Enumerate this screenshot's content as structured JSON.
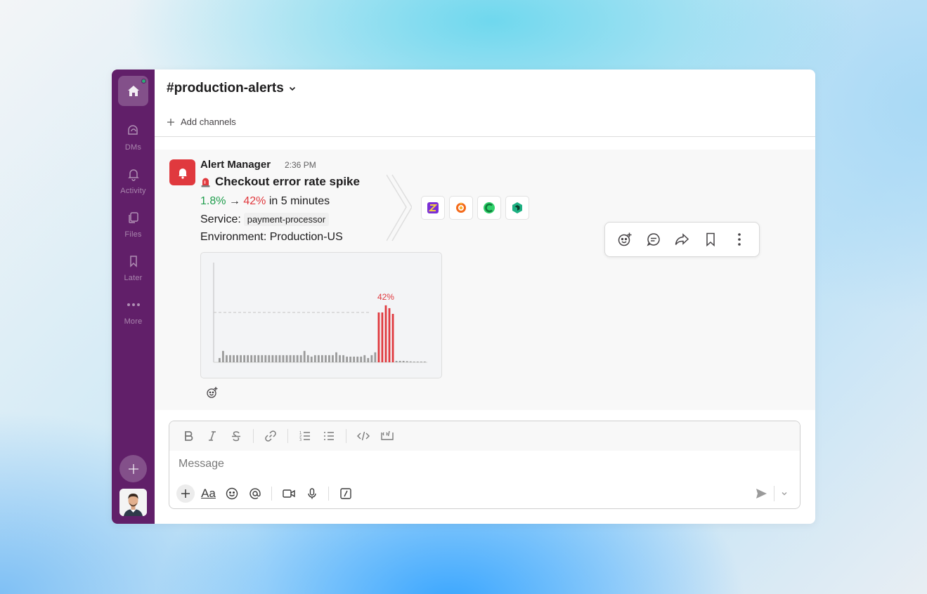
{
  "rail": {
    "items": [
      {
        "label": "DMs",
        "icon": "dms-icon"
      },
      {
        "label": "Activity",
        "icon": "bell-icon"
      },
      {
        "label": "Files",
        "icon": "files-icon"
      },
      {
        "label": "Later",
        "icon": "bookmark-icon"
      },
      {
        "label": "More",
        "icon": "more-dots-icon"
      }
    ],
    "home_icon": "home-icon",
    "presence_color": "#2bac76",
    "accent": "#611f69"
  },
  "header": {
    "channel_name": "#production-alerts",
    "add_channels": "Add channels"
  },
  "message": {
    "sender": "Alert Manager",
    "time": "2:36 PM",
    "title": "Checkout error rate spike",
    "rate_from": "1.8%",
    "arrow": "→",
    "rate_to": "42%",
    "rate_suffix": "in 5 minutes",
    "service_label": "Service:",
    "service_value": "payment-processor",
    "environment": "Environment: Production-US",
    "apps": [
      "app-icon-1",
      "grafana-icon",
      "app-icon-3",
      "app-icon-4"
    ],
    "alert_color": "#e0393e",
    "good_color": "#1f9d4c"
  },
  "chart_data": {
    "type": "bar",
    "annotation": "42%",
    "values": [
      3,
      8,
      5,
      5,
      5,
      5,
      5,
      5,
      5,
      5,
      5,
      5,
      5,
      5,
      5,
      5,
      5,
      5,
      5,
      5,
      5,
      5,
      5,
      5,
      8,
      5,
      4,
      5,
      5,
      5,
      5,
      5,
      5,
      7,
      5,
      5,
      4,
      4,
      4,
      4,
      4,
      5,
      3,
      5,
      7,
      35,
      35,
      40,
      38,
      34,
      1,
      1,
      1,
      0.8,
      0.6,
      0.4,
      0.3,
      0.2,
      0.1
    ],
    "highlight_indices": [
      45,
      46,
      47,
      48,
      49
    ],
    "highlight_color": "#e0393e",
    "bar_color": "#9a9a9a",
    "threshold": 35,
    "ylim": [
      0,
      70
    ],
    "grid": false
  },
  "toolbar": {
    "icons": [
      "add-reaction-icon",
      "reply-thread-icon",
      "share-icon",
      "save-icon",
      "more-actions-icon"
    ]
  },
  "composer": {
    "placeholder": "Message",
    "aa_label": "Aa"
  }
}
